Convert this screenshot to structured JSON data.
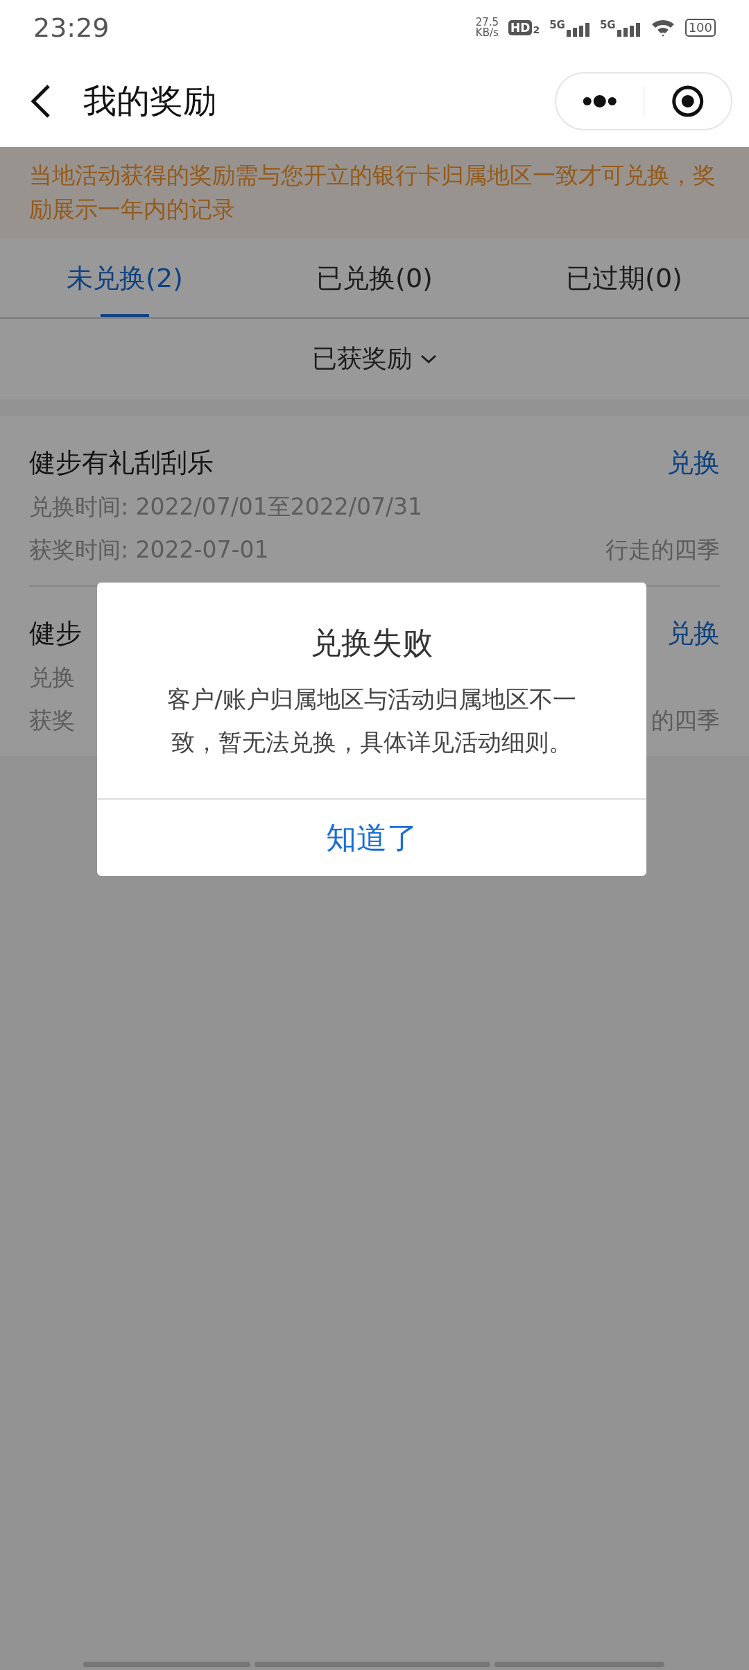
{
  "status_bar": {
    "time": "23:29",
    "speed": "27.5",
    "speed_unit": "KB/s",
    "hd": "HD",
    "hd_sub": "2",
    "signals": [
      {
        "label": "5G"
      },
      {
        "label": "5G"
      }
    ],
    "battery": "100"
  },
  "header": {
    "title": "我的奖励"
  },
  "notice": "当地活动获得的奖励需与您开立的银行卡归属地区一致才可兑换，奖励展示一年内的记录",
  "tabs": [
    {
      "label": "未兑换(2)",
      "selected": true
    },
    {
      "label": "已兑换(0)",
      "selected": false
    },
    {
      "label": "已过期(0)",
      "selected": false
    }
  ],
  "filter": {
    "label": "已获奖励"
  },
  "rewards": [
    {
      "title": "健步有礼刮刮乐",
      "exchange_time": "兑换时间: 2022/07/01至2022/07/31",
      "award_time": "获奖时间: 2022-07-01",
      "source": "行走的四季",
      "action": "兑换"
    },
    {
      "title": "健步",
      "exchange_time": "兑换",
      "award_time": "获奖",
      "source": "的四季",
      "action": "兑换"
    }
  ],
  "dialog": {
    "title": "兑换失败",
    "message": "客户/账户归属地区与活动归属地区不一致，暂无法兑换，具体详见活动细则。",
    "button": "知道了"
  }
}
